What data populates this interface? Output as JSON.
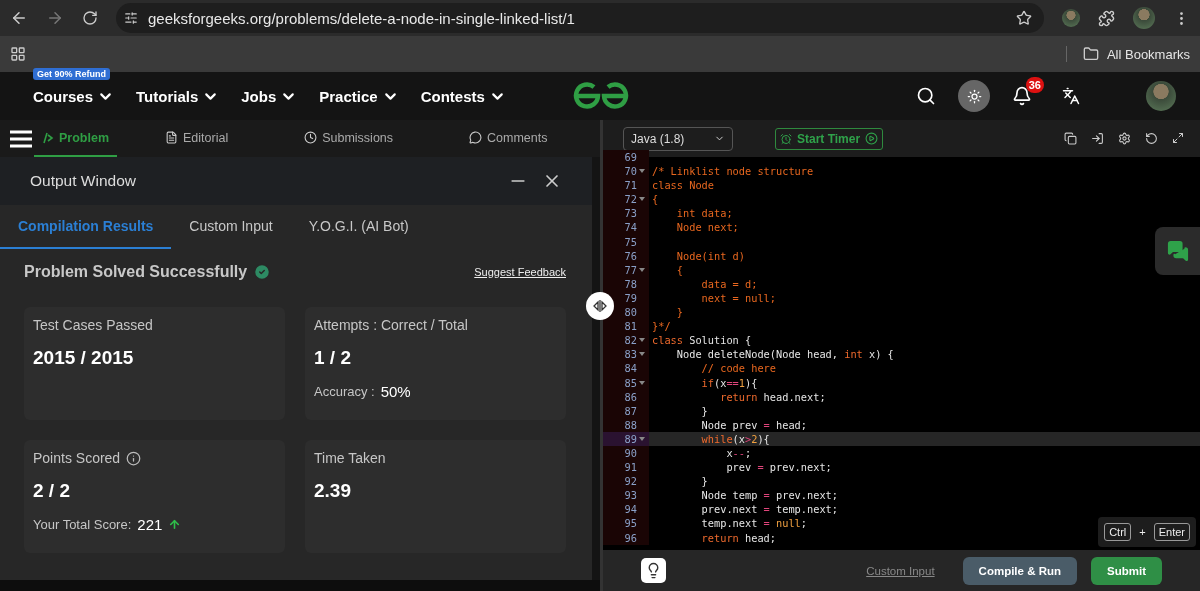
{
  "browser": {
    "url": "geeksforgeeks.org/problems/delete-a-node-in-single-linked-list/1",
    "bookmarks_label": "All Bookmarks"
  },
  "nav": {
    "promo_badge": "Get 90% Refund",
    "items": [
      "Courses",
      "Tutorials",
      "Jobs",
      "Practice",
      "Contests"
    ],
    "notification_count": "36"
  },
  "problem_tabs": [
    {
      "label": "Problem",
      "kind": "problem",
      "selected": true
    },
    {
      "label": "Editorial",
      "kind": "editorial",
      "selected": false
    },
    {
      "label": "Submissions",
      "kind": "submissions",
      "selected": false
    },
    {
      "label": "Comments",
      "kind": "comments",
      "selected": false
    }
  ],
  "output_window": {
    "title": "Output Window",
    "tabs": [
      {
        "label": "Compilation Results",
        "selected": true
      },
      {
        "label": "Custom Input",
        "selected": false
      },
      {
        "label": "Y.O.G.I. (AI Bot)",
        "selected": false
      }
    ],
    "status": "Problem Solved Successfully",
    "feedback_link": "Suggest Feedback",
    "cards": [
      {
        "label": "Test Cases Passed",
        "value": "2015 / 2015"
      },
      {
        "label": "Attempts : Correct / Total",
        "value": "1 / 2",
        "note": {
          "label": "Accuracy :",
          "value": "50%"
        }
      },
      {
        "label": "Points Scored",
        "value": "2 / 2",
        "info": true,
        "note": {
          "label": "Your Total Score:",
          "value": "221",
          "trend_up": true
        }
      },
      {
        "label": "Time Taken",
        "value": "2.39"
      }
    ]
  },
  "editor": {
    "language": "Java (1.8)",
    "timer_button": "Start Timer",
    "lines": [
      {
        "number": "69",
        "fold": false,
        "active": false
      },
      {
        "number": "70",
        "fold": true,
        "active": false,
        "segments": [
          {
            "kind": "c",
            "text": "/* Linklist node structure"
          }
        ]
      },
      {
        "number": "71",
        "fold": false,
        "active": false,
        "segments": [
          {
            "kind": "c",
            "text": "class Node"
          }
        ]
      },
      {
        "number": "72",
        "fold": true,
        "active": false,
        "segments": [
          {
            "kind": "c",
            "text": "{"
          }
        ]
      },
      {
        "number": "73",
        "fold": false,
        "active": false,
        "segments": [
          {
            "kind": "c",
            "text": "    int data;"
          }
        ]
      },
      {
        "number": "74",
        "fold": false,
        "active": false,
        "segments": [
          {
            "kind": "c",
            "text": "    Node next;"
          }
        ]
      },
      {
        "number": "75",
        "fold": false,
        "active": false
      },
      {
        "number": "76",
        "fold": false,
        "active": false,
        "segments": [
          {
            "kind": "c",
            "text": "    Node(int d)"
          }
        ]
      },
      {
        "number": "77",
        "fold": true,
        "active": false,
        "segments": [
          {
            "kind": "c",
            "text": "    {"
          }
        ]
      },
      {
        "number": "78",
        "fold": false,
        "active": false,
        "segments": [
          {
            "kind": "c",
            "text": "        data = d;"
          }
        ]
      },
      {
        "number": "79",
        "fold": false,
        "active": false,
        "segments": [
          {
            "kind": "c",
            "text": "        next = null;"
          }
        ]
      },
      {
        "number": "80",
        "fold": false,
        "active": false,
        "segments": [
          {
            "kind": "c",
            "text": "    }"
          }
        ]
      },
      {
        "number": "81",
        "fold": false,
        "active": false,
        "segments": [
          {
            "kind": "c",
            "text": "}*/"
          }
        ]
      },
      {
        "number": "82",
        "fold": true,
        "active": false,
        "segments": [
          {
            "kind": "k",
            "text": "class"
          },
          {
            "kind": "p",
            "text": " Solution {"
          }
        ]
      },
      {
        "number": "83",
        "fold": true,
        "active": false,
        "segments": [
          {
            "kind": "p",
            "text": "    Node deleteNode(Node head, "
          },
          {
            "kind": "k",
            "text": "int"
          },
          {
            "kind": "p",
            "text": " x) {"
          }
        ]
      },
      {
        "number": "84",
        "fold": false,
        "active": false,
        "segments": [
          {
            "kind": "c",
            "text": "        // code here"
          }
        ]
      },
      {
        "number": "85",
        "fold": true,
        "active": false,
        "segments": [
          {
            "kind": "k",
            "text": "        if"
          },
          {
            "kind": "p",
            "text": "(x"
          },
          {
            "kind": "o",
            "text": "=="
          },
          {
            "kind": "n",
            "text": "1"
          },
          {
            "kind": "p",
            "text": "){"
          }
        ]
      },
      {
        "number": "86",
        "fold": false,
        "active": false,
        "segments": [
          {
            "kind": "k",
            "text": "           return"
          },
          {
            "kind": "p",
            "text": " head.next;"
          }
        ]
      },
      {
        "number": "87",
        "fold": false,
        "active": false,
        "segments": [
          {
            "kind": "p",
            "text": "        }"
          }
        ]
      },
      {
        "number": "88",
        "fold": false,
        "active": false,
        "segments": [
          {
            "kind": "p",
            "text": "        Node prev "
          },
          {
            "kind": "o",
            "text": "="
          },
          {
            "kind": "p",
            "text": " head;"
          }
        ]
      },
      {
        "number": "89",
        "fold": true,
        "active": true,
        "segments": [
          {
            "kind": "k",
            "text": "        while"
          },
          {
            "kind": "p",
            "text": "(x"
          },
          {
            "kind": "o",
            "text": ">"
          },
          {
            "kind": "n",
            "text": "2"
          },
          {
            "kind": "p",
            "text": "){"
          }
        ]
      },
      {
        "number": "90",
        "fold": false,
        "active": false,
        "segments": [
          {
            "kind": "p",
            "text": "            x"
          },
          {
            "kind": "o",
            "text": "--"
          },
          {
            "kind": "p",
            "text": ";"
          }
        ]
      },
      {
        "number": "91",
        "fold": false,
        "active": false,
        "segments": [
          {
            "kind": "p",
            "text": "            prev "
          },
          {
            "kind": "o",
            "text": "="
          },
          {
            "kind": "p",
            "text": " prev.next;"
          }
        ]
      },
      {
        "number": "92",
        "fold": false,
        "active": false,
        "segments": [
          {
            "kind": "p",
            "text": "        }"
          }
        ]
      },
      {
        "number": "93",
        "fold": false,
        "active": false,
        "segments": [
          {
            "kind": "p",
            "text": "        Node temp "
          },
          {
            "kind": "o",
            "text": "="
          },
          {
            "kind": "p",
            "text": " prev.next;"
          }
        ]
      },
      {
        "number": "94",
        "fold": false,
        "active": false,
        "segments": [
          {
            "kind": "p",
            "text": "        prev.next "
          },
          {
            "kind": "o",
            "text": "="
          },
          {
            "kind": "p",
            "text": " temp.next;"
          }
        ]
      },
      {
        "number": "95",
        "fold": false,
        "active": false,
        "segments": [
          {
            "kind": "p",
            "text": "        temp.next "
          },
          {
            "kind": "o",
            "text": "="
          },
          {
            "kind": "n",
            "text": " null"
          },
          {
            "kind": "p",
            "text": ";"
          }
        ]
      },
      {
        "number": "96",
        "fold": false,
        "active": false,
        "segments": [
          {
            "kind": "k",
            "text": "        return"
          },
          {
            "kind": "p",
            "text": " head;"
          }
        ]
      }
    ],
    "shortcut": {
      "keys": [
        "Ctrl",
        "Enter"
      ],
      "joiner": "+"
    },
    "custom_input_link": "Custom Input",
    "buttons": [
      {
        "label": "Compile & Run",
        "kind": "secondary"
      },
      {
        "label": "Submit",
        "kind": "primary"
      }
    ]
  }
}
